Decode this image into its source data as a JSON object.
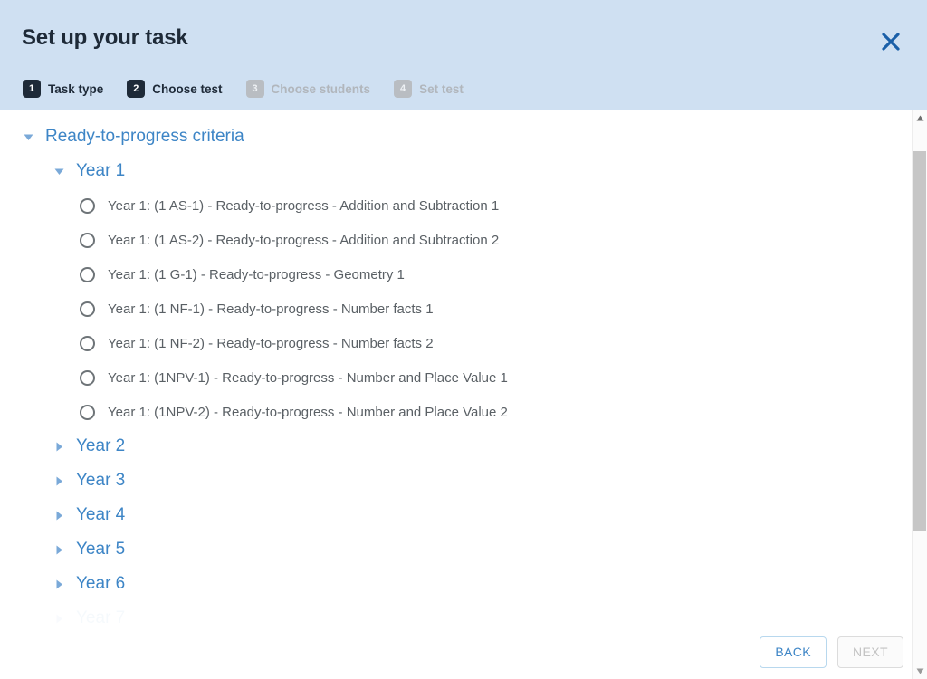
{
  "header": {
    "title": "Set up your task",
    "close_icon": "close-icon",
    "accent_blue": "#3d85c6",
    "header_bg": "#cfe0f2",
    "dark_navy": "#1e2a38"
  },
  "steps": [
    {
      "num": "1",
      "label": "Task type",
      "state": "active"
    },
    {
      "num": "2",
      "label": "Choose test",
      "state": "active"
    },
    {
      "num": "3",
      "label": "Choose students",
      "state": "disabled"
    },
    {
      "num": "4",
      "label": "Set test",
      "state": "disabled"
    }
  ],
  "tree": {
    "root": {
      "label": "Ready-to-progress criteria",
      "expanded": true,
      "triangle": "triangle-down-icon"
    },
    "year1": {
      "label": "Year 1",
      "expanded": true,
      "triangle": "triangle-down-icon"
    },
    "year1_items": [
      {
        "label": "Year 1: (1 AS-1) - Ready-to-progress - Addition and Subtraction 1",
        "selected": false
      },
      {
        "label": "Year 1: (1 AS-2) - Ready-to-progress - Addition and Subtraction 2",
        "selected": false
      },
      {
        "label": "Year 1: (1 G-1) - Ready-to-progress - Geometry 1",
        "selected": false
      },
      {
        "label": "Year 1: (1 NF-1) - Ready-to-progress - Number facts 1",
        "selected": false
      },
      {
        "label": "Year 1: (1 NF-2) - Ready-to-progress - Number facts 2",
        "selected": false
      },
      {
        "label": "Year 1: (1NPV-1) - Ready-to-progress - Number and Place Value 1",
        "selected": false
      },
      {
        "label": "Year 1: (1NPV-2) - Ready-to-progress - Number and Place Value 2",
        "selected": false
      }
    ],
    "collapsed_years": [
      {
        "label": "Year 2",
        "expanded": false,
        "triangle": "triangle-right-icon"
      },
      {
        "label": "Year 3",
        "expanded": false,
        "triangle": "triangle-right-icon"
      },
      {
        "label": "Year 4",
        "expanded": false,
        "triangle": "triangle-right-icon"
      },
      {
        "label": "Year 5",
        "expanded": false,
        "triangle": "triangle-right-icon"
      },
      {
        "label": "Year 6",
        "expanded": false,
        "triangle": "triangle-right-icon"
      }
    ],
    "cutoff_year": {
      "label": "Year 7"
    }
  },
  "scrollbar": {
    "up_icon": "scroll-up-arrow-icon",
    "down_icon": "scroll-down-arrow-icon",
    "thumb": "scrollbar-thumb"
  },
  "footer": {
    "back_label": "BACK",
    "next_label": "NEXT",
    "next_disabled": true
  }
}
